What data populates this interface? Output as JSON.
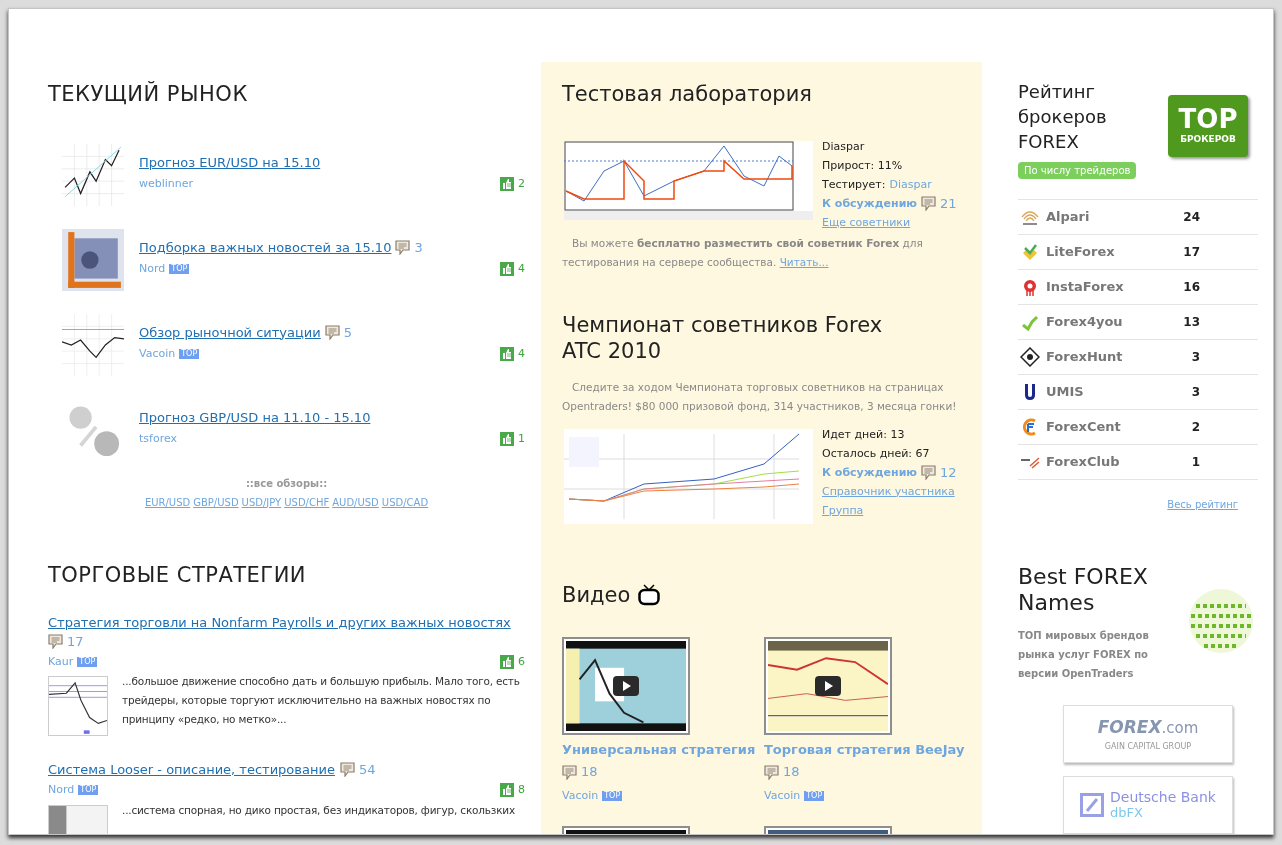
{
  "market": {
    "title": "ТЕКУЩИЙ РЫНОК",
    "items": [
      {
        "title": "Прогноз EUR/USD на 15.10",
        "author": "weblinner",
        "rating": "2"
      },
      {
        "title": "Подборка важных новостей за 15.10",
        "comments": "3",
        "author": "Nord",
        "badge": "TOP",
        "rating": "4"
      },
      {
        "title": "Обзор рыночной ситуации",
        "comments": "5",
        "author": "Vacoin",
        "badge": "TOP",
        "rating": "4"
      },
      {
        "title": "Прогноз GBP/USD на 11.10 - 15.10",
        "author": "tsforex",
        "rating": "1"
      }
    ],
    "all_label": "::все обзоры::",
    "pairs": [
      "EUR/USD",
      "GBP/USD",
      "USD/JPY",
      "USD/CHF",
      "AUD/USD",
      "USD/CAD"
    ]
  },
  "strategies": {
    "title": "ТОРГОВЫЕ СТРАТЕГИИ",
    "items": [
      {
        "title": "Стратегия торговли на Nonfarm Payrolls и других важных новостях",
        "comments": "17",
        "author": "Kaur",
        "badge": "TOP",
        "rating": "6",
        "excerpt": "...большое движение способно дать и большую прибыль. Мало того, есть трейдеры, которые торгуют исключительно на важных новостях по принципу «редко, но метко»..."
      },
      {
        "title": "Система Looser - описание, тестирование",
        "comments": "54",
        "author": "Nord",
        "badge": "TOP",
        "rating": "8",
        "excerpt": "...система спорная, но дико простая, без индикаторов, фигур, скользких"
      }
    ]
  },
  "lab": {
    "title": "Тестовая лаборатория",
    "bot": "Diaspar",
    "growth": "Прирост: 11%",
    "tester_label": "Тестирует:",
    "tester": "Diaspar",
    "discuss": "К обсуждению",
    "comments": "21",
    "more": "Еще советники",
    "note": "Вы можете **бесплатно разместить свой советник Forex** для тестирования на сервере сообщества.",
    "read_more": "Читать..."
  },
  "championship": {
    "title": "Чемпионат советников Forex ATC 2010",
    "text": "Следите за ходом Чемпионата торговых советников на страницах Opentraders! $80 000 призовой фонд, 314 участников, 3 месяца гонки!",
    "days_passed": "Идет дней: 13",
    "days_left": "Осталось дней: 67",
    "discuss": "К обсуждению",
    "comments": "12",
    "links": [
      "Справочник участника",
      "Группа"
    ]
  },
  "video": {
    "title": "Видео",
    "items": [
      {
        "title": "Универсальная стратегия",
        "comments": "18",
        "author": "Vacoin",
        "badge": "TOP"
      },
      {
        "title": "Торговая стратегия BeeJay",
        "comments": "18",
        "author": "Vacoin",
        "badge": "TOP"
      }
    ]
  },
  "rating": {
    "title": "Рейтинг брокеров FOREX",
    "filter": "По числу трейдеров",
    "logo_title": "TOP",
    "logo_subtitle": "БРОКЕРОВ",
    "brokers": [
      {
        "name": "Alpari",
        "count": "24"
      },
      {
        "name": "LiteForex",
        "count": "17"
      },
      {
        "name": "InstaForex",
        "count": "16"
      },
      {
        "name": "Forex4you",
        "count": "13"
      },
      {
        "name": "ForexHunt",
        "count": "3"
      },
      {
        "name": "UMIS",
        "count": "3"
      },
      {
        "name": "ForexCent",
        "count": "2"
      },
      {
        "name": "ForexClub",
        "count": "1"
      }
    ],
    "all_link": "Весь рейтинг"
  },
  "names": {
    "title": "Best FOREX Names",
    "subtitle": "ТОП мировых брендов рынка услуг FOREX по версии OpenTraders",
    "banner_1": {
      "brand": "FOREX",
      "suffix": ".com",
      "tagline": "GAIN CAPITAL GROUP"
    },
    "banner_2": {
      "brand": "Deutsche Bank",
      "suffix": "dbFX"
    }
  }
}
